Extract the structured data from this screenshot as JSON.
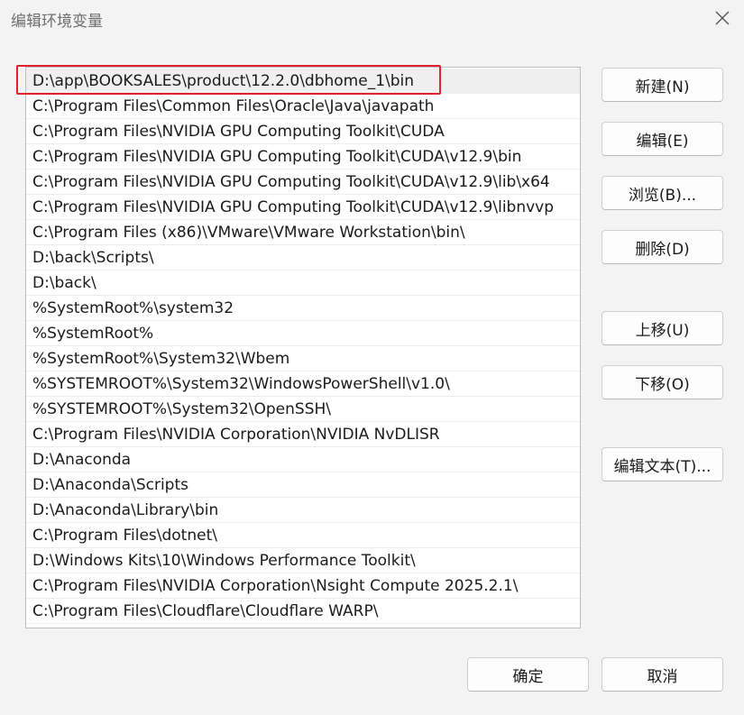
{
  "window": {
    "title": "编辑环境变量",
    "close_icon": "close-icon"
  },
  "path_list": {
    "selected_index": 0,
    "items": [
      "D:\\app\\BOOKSALES\\product\\12.2.0\\dbhome_1\\bin",
      "C:\\Program Files\\Common Files\\Oracle\\Java\\javapath",
      "C:\\Program Files\\NVIDIA GPU Computing Toolkit\\CUDA",
      "C:\\Program Files\\NVIDIA GPU Computing Toolkit\\CUDA\\v12.9\\bin",
      "C:\\Program Files\\NVIDIA GPU Computing Toolkit\\CUDA\\v12.9\\lib\\x64",
      "C:\\Program Files\\NVIDIA GPU Computing Toolkit\\CUDA\\v12.9\\libnvvp",
      "C:\\Program Files (x86)\\VMware\\VMware Workstation\\bin\\",
      "D:\\back\\Scripts\\",
      "D:\\back\\",
      "%SystemRoot%\\system32",
      "%SystemRoot%",
      "%SystemRoot%\\System32\\Wbem",
      "%SYSTEMROOT%\\System32\\WindowsPowerShell\\v1.0\\",
      "%SYSTEMROOT%\\System32\\OpenSSH\\",
      "C:\\Program Files\\NVIDIA Corporation\\NVIDIA NvDLISR",
      "D:\\Anaconda",
      "D:\\Anaconda\\Scripts",
      "D:\\Anaconda\\Library\\bin",
      "C:\\Program Files\\dotnet\\",
      "D:\\Windows Kits\\10\\Windows Performance Toolkit\\",
      "C:\\Program Files\\NVIDIA Corporation\\Nsight Compute 2025.2.1\\",
      "C:\\Program Files\\Cloudflare\\Cloudflare WARP\\"
    ]
  },
  "side_buttons": {
    "new": "新建(N)",
    "edit": "编辑(E)",
    "browse": "浏览(B)...",
    "delete": "删除(D)",
    "move_up": "上移(U)",
    "move_down": "下移(O)",
    "edit_text": "编辑文本(T)..."
  },
  "footer_buttons": {
    "ok": "确定",
    "cancel": "取消"
  },
  "colors": {
    "highlight_border": "#e0202a",
    "selected_row": "#efefef"
  }
}
